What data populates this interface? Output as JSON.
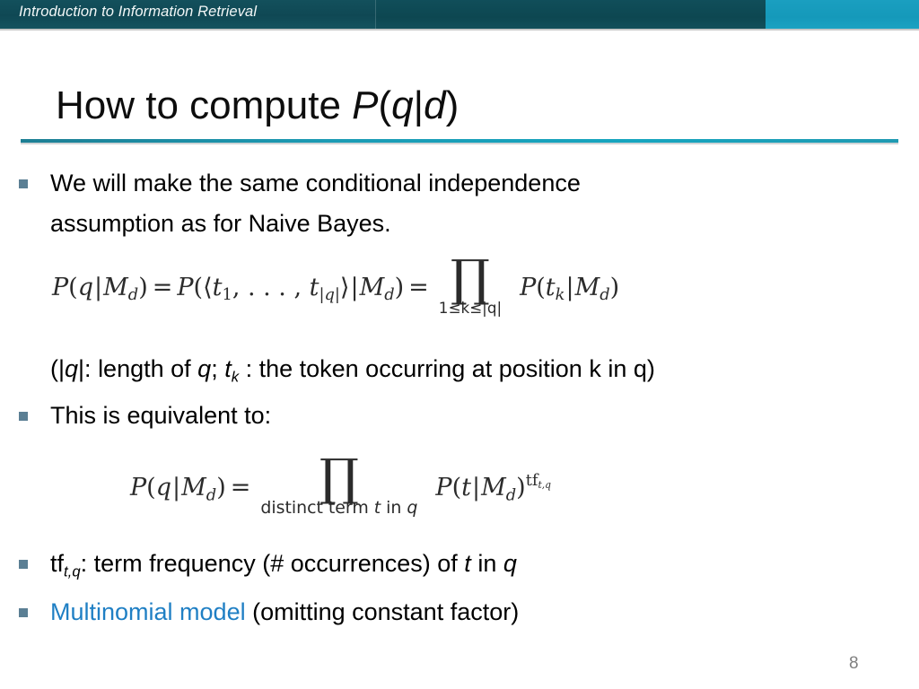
{
  "banner": {
    "title": "Introduction to Information Retrieval",
    "accent_dark": "#0f4854",
    "accent_light": "#1a9fc0"
  },
  "slide": {
    "title_prefix": "How to compute ",
    "title_math_p": "P",
    "title_math_open": "(",
    "title_math_q": "q",
    "title_math_bar": "|",
    "title_math_d": "d",
    "title_math_close": ")",
    "page_number": "8"
  },
  "content": {
    "bullet1_line1": "We will make the same conditional independence",
    "bullet1_line2": "assumption as for Naive Bayes.",
    "note_open": "(|",
    "note_q1": "q",
    "note_after_q1": "|: length of ",
    "note_q2": "q",
    "note_semicolon": "; ",
    "note_t": "t",
    "note_t_sub": "k",
    "note_tail": " : the token occurring at position k in q)",
    "bullet2": "This is equivalent to:",
    "bullet3_tf": "tf",
    "bullet3_tf_sub": "t,q",
    "bullet3_mid": ": term frequency (# occurrences) of ",
    "bullet3_t": "t",
    "bullet3_in": " in ",
    "bullet3_q": "q",
    "bullet4_link": "Multinomial model",
    "bullet4_rest": " (omitting constant factor)",
    "link_color": "#1f7fc4",
    "bullet_marker_color": "#5b7f94"
  },
  "formula1": {
    "lhs_p": "P",
    "lhs_open": "(",
    "lhs_q": "q",
    "lhs_bar": "|",
    "lhs_m": "M",
    "lhs_m_sub": "d",
    "lhs_close": ")",
    "eq1": "=",
    "mid_p": "P",
    "mid_open": "(⟨",
    "mid_t1": "t",
    "mid_t1_sub": "1",
    "mid_dots": ", . . . , ",
    "mid_t2": "t",
    "mid_t2_sub": "|q|",
    "mid_close_angle": "⟩",
    "mid_bar": "|",
    "mid_m": "M",
    "mid_m_sub": "d",
    "mid_close": ")",
    "eq2": "=",
    "prod_glyph": "∏",
    "prod_limits": "1≤k≤|q|",
    "rhs_p": "P",
    "rhs_open": "(",
    "rhs_t": "t",
    "rhs_t_sub": "k",
    "rhs_bar": "|",
    "rhs_m": "M",
    "rhs_m_sub": "d",
    "rhs_close": ")"
  },
  "formula2": {
    "lhs_p": "P",
    "lhs_open": "(",
    "lhs_q": "q",
    "lhs_bar": "|",
    "lhs_m": "M",
    "lhs_m_sub": "d",
    "lhs_close": ")",
    "eq": "=",
    "prod_glyph": "∏",
    "prod_limits_pre": "distinct term ",
    "prod_limits_t": "t",
    "prod_limits_mid": " in ",
    "prod_limits_q": "q",
    "rhs_p": "P",
    "rhs_open": "(",
    "rhs_t": "t",
    "rhs_bar": "|",
    "rhs_m": "M",
    "rhs_m_sub": "d",
    "rhs_close": ")",
    "rhs_exp_tf": "tf",
    "rhs_exp_sub": "t,q"
  }
}
